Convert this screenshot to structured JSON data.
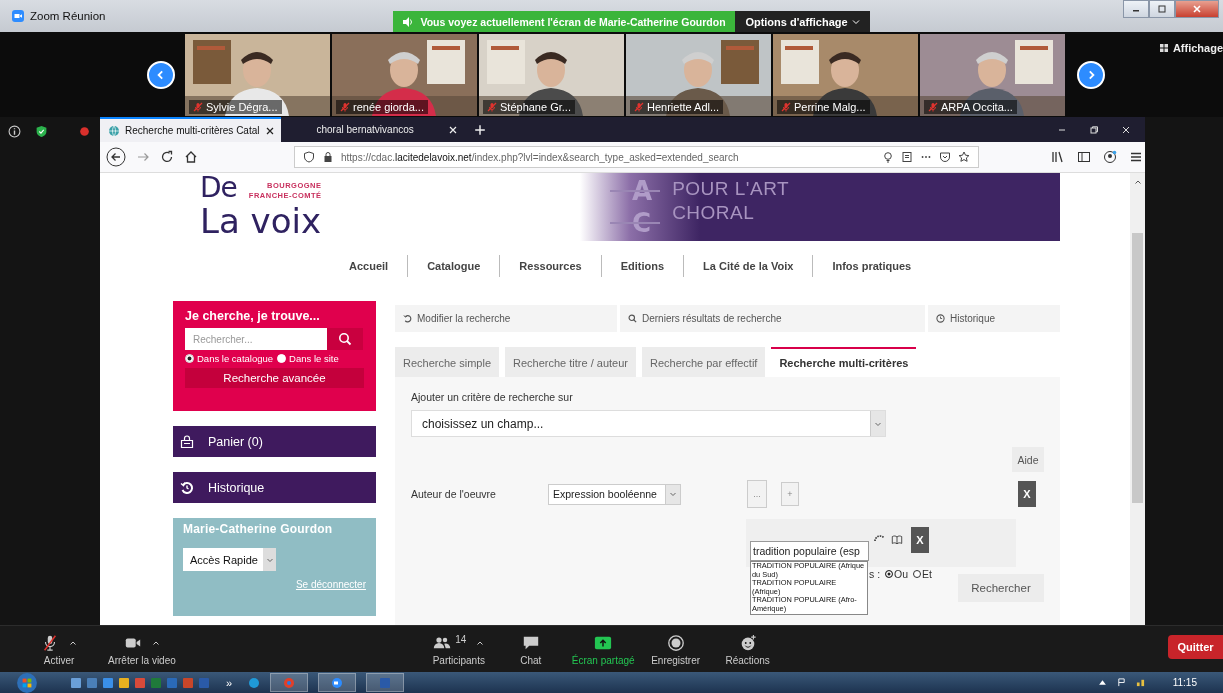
{
  "zoom": {
    "title": "Zoom Réunion",
    "banner": "Vous voyez actuellement l'écran de Marie-Catherine Gourdon",
    "view_options": "Options d'affichage",
    "view_button": "Affichage"
  },
  "participants": [
    {
      "name": "Sylvie Dégra...",
      "muted": true
    },
    {
      "name": "renée giorda...",
      "muted": true
    },
    {
      "name": "Stéphane Gr...",
      "muted": true
    },
    {
      "name": "Henriette Adl...",
      "muted": true
    },
    {
      "name": "Perrine Malg...",
      "muted": true
    },
    {
      "name": "ARPA Occita...",
      "muted": true
    }
  ],
  "browser": {
    "tabs": [
      {
        "label": "Recherche multi-critères Catal",
        "selected": true
      },
      {
        "label": "choral bernatvivancos",
        "selected": false
      }
    ],
    "url": "https://cdac.**lacitedelavoix.net**/index.php?lvl=index&search_type_asked=extended_search"
  },
  "site": {
    "logo": {
      "line_1": "De",
      "line_2": "La voix",
      "region_1": "BOURGOGNE",
      "region_2": "FRANCHE-COMTÉ",
      "mark_letters": [
        "A",
        "C"
      ],
      "tagline_1": "POUR L'ART",
      "tagline_2": "CHORAL"
    },
    "nav": [
      "Accueil",
      "Catalogue",
      "Ressources",
      "Editions",
      "La Cité de la Voix",
      "Infos pratiques"
    ]
  },
  "search_box": {
    "title": "Je cherche, je trouve...",
    "placeholder": "Rechercher...",
    "scopes": [
      {
        "label": "Dans le catalogue",
        "selected": true
      },
      {
        "label": "Dans le site",
        "selected": false
      }
    ],
    "advanced": "Recherche avancée"
  },
  "side_links": [
    {
      "kind": "basket",
      "label": "Panier (0)"
    },
    {
      "kind": "history",
      "label": "Historique"
    }
  ],
  "account": {
    "name": "Marie-Catherine Gourdon",
    "quick_access": "Accès Rapide",
    "logout": "Se déconnecter"
  },
  "search_actions": [
    {
      "kind": "modify",
      "label": "Modifier la recherche"
    },
    {
      "kind": "recent",
      "label": "Derniers résultats de recherche"
    },
    {
      "kind": "history",
      "label": "Historique"
    }
  ],
  "search_tabs": [
    {
      "label": "Recherche simple",
      "selected": false
    },
    {
      "label": "Recherche titre / auteur",
      "selected": false
    },
    {
      "label": "Recherche par effectif",
      "selected": false
    },
    {
      "label": "Recherche multi-critères",
      "selected": true
    }
  ],
  "criteria": {
    "add_label": "Ajouter un critère de recherche sur",
    "field_select": "choisissez un champ...",
    "help": "Aide",
    "row": {
      "label": "Auteur de l'oeuvre",
      "operator": "Expression booléenne",
      "more": "...",
      "add": "+",
      "remove": "X",
      "value": "tradition populaire (esp",
      "value_remove": "X",
      "suggestions": [
        "TRADITION POPULAIRE (Afrique du Sud)",
        "TRADITION POPULAIRE (Afrique)",
        "TRADITION POPULAIRE (Afro-Amérique)"
      ],
      "logic_label": "s :",
      "logic": [
        {
          "label": "Ou",
          "selected": true
        },
        {
          "label": "Et",
          "selected": false
        }
      ]
    },
    "submit": "Rechercher"
  },
  "toolbar": {
    "items": [
      {
        "kind": "mic",
        "label": "Activer",
        "caret": true
      },
      {
        "kind": "video",
        "label": "Arrêter la video",
        "caret": true
      },
      {
        "kind": "participants",
        "label": "Participants",
        "count": "14",
        "caret": true
      },
      {
        "kind": "chat",
        "label": "Chat",
        "caret": false
      },
      {
        "kind": "share",
        "label": "Écran partagé",
        "caret": false
      },
      {
        "kind": "record",
        "label": "Enregistrer",
        "caret": false
      },
      {
        "kind": "reactions",
        "label": "Réactions",
        "caret": false
      }
    ],
    "leave": "Quitter"
  },
  "taskbar": {
    "overflow": "»",
    "time": "11:15"
  }
}
